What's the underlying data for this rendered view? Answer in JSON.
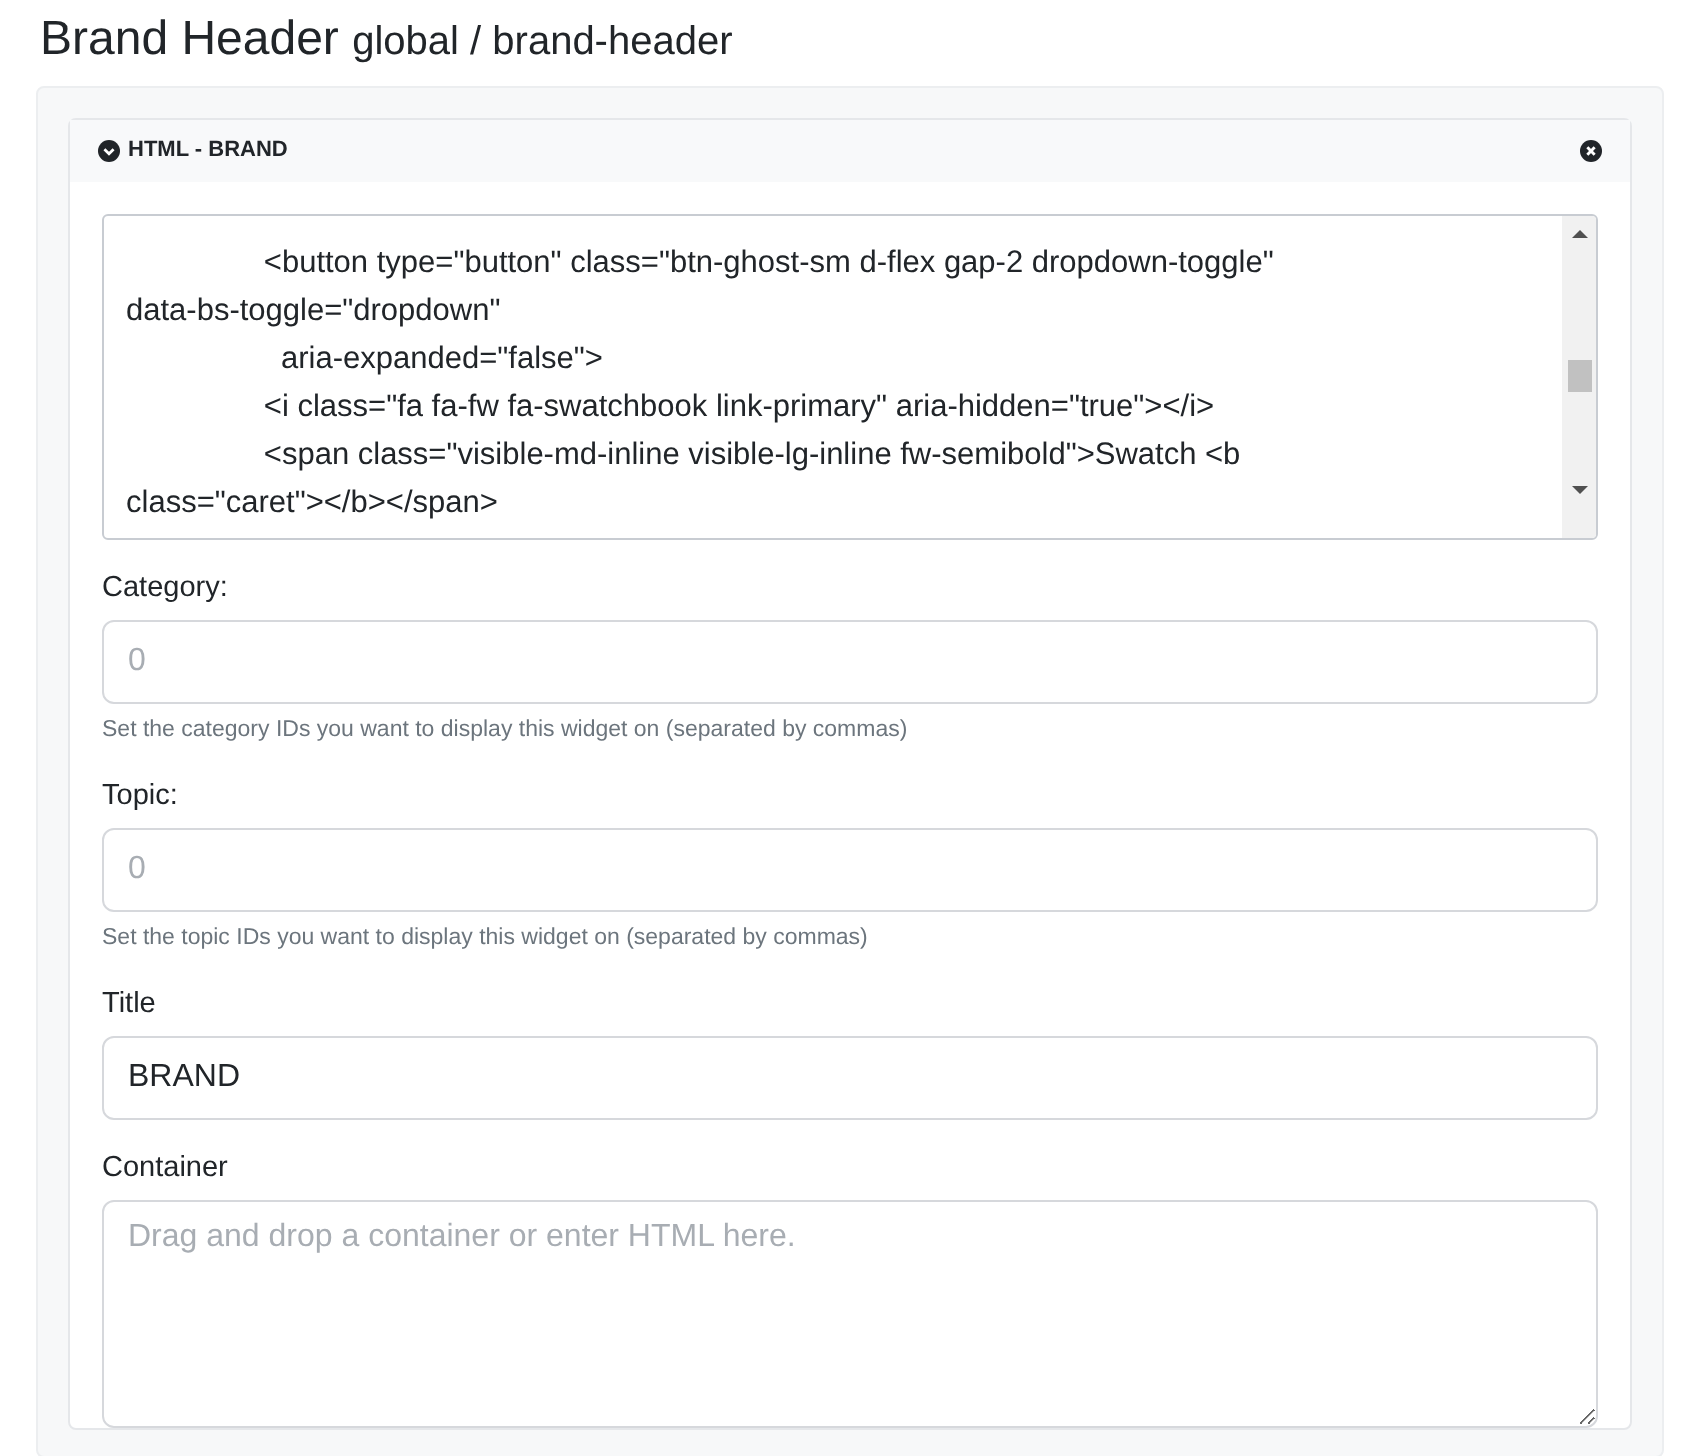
{
  "page_title": {
    "name": "Brand Header",
    "path": "global / brand-header"
  },
  "widget": {
    "title": "HTML - BRAND",
    "expanded": true,
    "code_lines": [
      "                <button type=\"button\" class=\"btn-ghost-sm d-flex gap-2 dropdown-toggle\"",
      "data-bs-toggle=\"dropdown\"",
      "                  aria-expanded=\"false\">",
      "                <i class=\"fa fa-fw fa-swatchbook link-primary\" aria-hidden=\"true\"></i>",
      "                <span class=\"visible-md-inline visible-lg-inline fw-semibold\">Swatch <b",
      "class=\"caret\"></b></span>"
    ],
    "fields": [
      {
        "kind": "input",
        "label": "Category:",
        "placeholder": "0",
        "help": "Set the category IDs you want to display this widget on (separated by commas)"
      },
      {
        "kind": "input",
        "label": "Topic:",
        "placeholder": "0",
        "help": "Set the topic IDs you want to display this widget on (separated by commas)"
      },
      {
        "kind": "input",
        "label": "Title",
        "value": "BRAND"
      },
      {
        "kind": "textarea",
        "label": "Container",
        "placeholder": "Drag and drop a container or enter HTML here."
      }
    ]
  }
}
